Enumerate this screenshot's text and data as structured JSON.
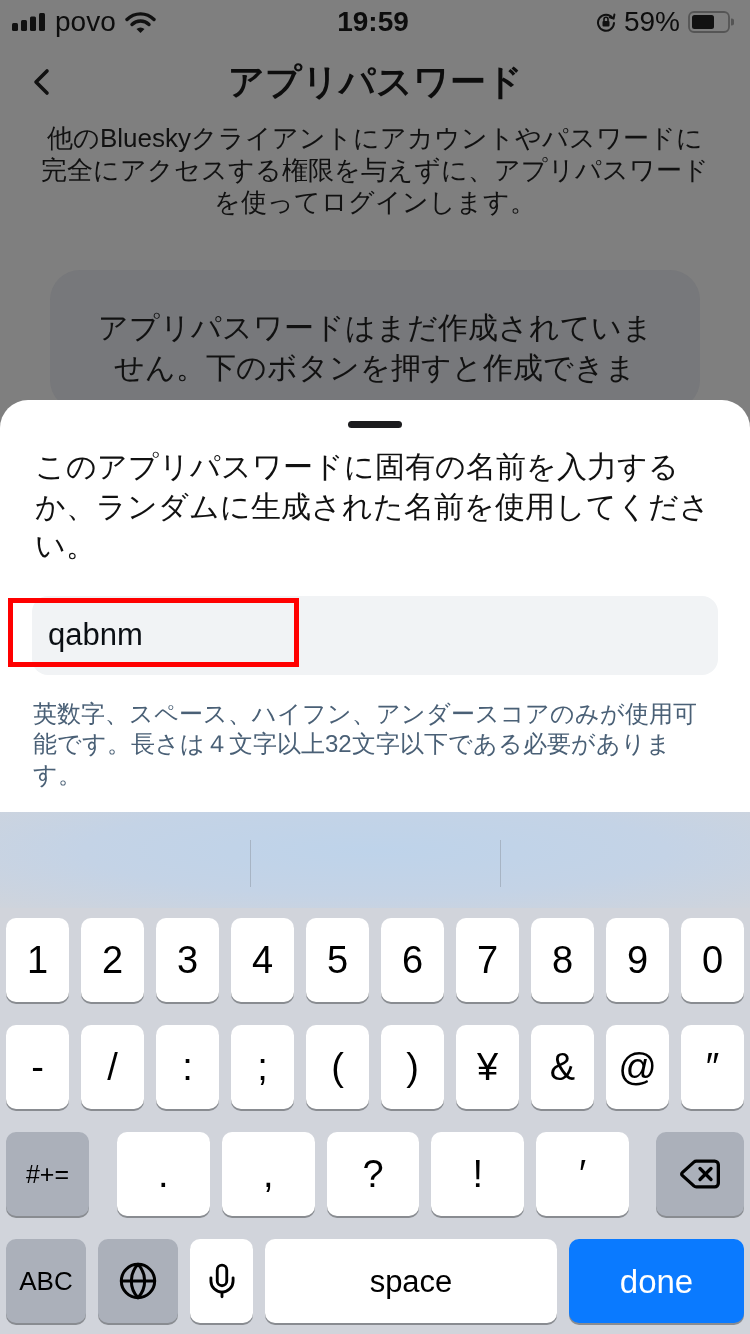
{
  "status_bar": {
    "carrier": "povo",
    "time": "19:59",
    "battery": "59%"
  },
  "header": {
    "title": "アプリパスワード"
  },
  "description": "他のBlueskyクライアントにアカウントやパスワードに完全にアクセスする権限を与えずに、アプリパスワードを使ってログインします。",
  "empty_notice": {
    "text": "アプリパスワードはまだ作成されていません。下のボタンを押すと作成できま"
  },
  "sheet": {
    "prompt": "このアプリパスワードに固有の名前を入力するか、ランダムに生成された名前を使用してください。",
    "name_field": {
      "value": "qabnm",
      "highlighted": true
    },
    "hint": "英数字、スペース、ハイフン、アンダースコアのみが使用可能です。長さは４文字以上32文字以下である必要があります。"
  },
  "keyboard": {
    "rows": [
      {
        "keys": [
          {
            "kind": "char",
            "label": "1"
          },
          {
            "kind": "char",
            "label": "2"
          },
          {
            "kind": "char",
            "label": "3"
          },
          {
            "kind": "char",
            "label": "4"
          },
          {
            "kind": "char",
            "label": "5"
          },
          {
            "kind": "char",
            "label": "6"
          },
          {
            "kind": "char",
            "label": "7"
          },
          {
            "kind": "char",
            "label": "8"
          },
          {
            "kind": "char",
            "label": "9"
          },
          {
            "kind": "char",
            "label": "0"
          }
        ]
      },
      {
        "keys": [
          {
            "kind": "char",
            "label": "-"
          },
          {
            "kind": "char",
            "label": "/"
          },
          {
            "kind": "char",
            "label": ":"
          },
          {
            "kind": "char",
            "label": ";"
          },
          {
            "kind": "char",
            "label": "("
          },
          {
            "kind": "char",
            "label": ")"
          },
          {
            "kind": "char",
            "label": "¥"
          },
          {
            "kind": "char",
            "label": "&"
          },
          {
            "kind": "char",
            "label": "@"
          },
          {
            "kind": "char",
            "label": "″"
          }
        ]
      },
      {
        "keys": [
          {
            "kind": "more_symbols",
            "label": "#+="
          },
          {
            "kind": "char",
            "label": "."
          },
          {
            "kind": "char",
            "label": ","
          },
          {
            "kind": "char",
            "label": "?"
          },
          {
            "kind": "char",
            "label": "!"
          },
          {
            "kind": "char",
            "label": "′"
          },
          {
            "kind": "delete"
          }
        ]
      },
      {
        "keys": [
          {
            "kind": "abc",
            "label": "ABC"
          },
          {
            "kind": "globe"
          },
          {
            "kind": "mic"
          },
          {
            "kind": "space",
            "label": "space"
          },
          {
            "kind": "done",
            "label": "done"
          }
        ]
      }
    ]
  }
}
